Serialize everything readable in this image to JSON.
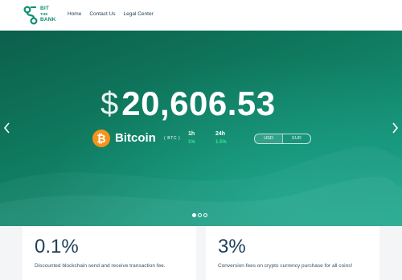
{
  "brand": {
    "line1": "BIT",
    "line2": "THE",
    "line3": "BANK",
    "color": "#0e8f72"
  },
  "nav": {
    "links": [
      "Home",
      "Contact Us",
      "Legal Center"
    ]
  },
  "hero": {
    "currency_symbol": "$",
    "price": "20,606.53",
    "coin": {
      "icon_glyph": "₿",
      "name": "Bitcoin",
      "ticker": "( BTC )",
      "color": "#f7931a"
    },
    "changes": [
      {
        "label": "1h",
        "value": "1%"
      },
      {
        "label": "24h",
        "value": "1.5%"
      }
    ],
    "currency_options": [
      "USD",
      "EUR"
    ],
    "selected_currency": "USD",
    "slide_count": 3,
    "active_slide": 1
  },
  "stats": [
    {
      "value": "0.1%",
      "text": "Discounted blockchain send and receive transaction fee."
    },
    {
      "value": "3%",
      "text": "Conversion fees on crypto currency purchase for all coins!"
    }
  ],
  "icons": {
    "prev": "chevron-left-icon",
    "next": "chevron-right-icon"
  }
}
